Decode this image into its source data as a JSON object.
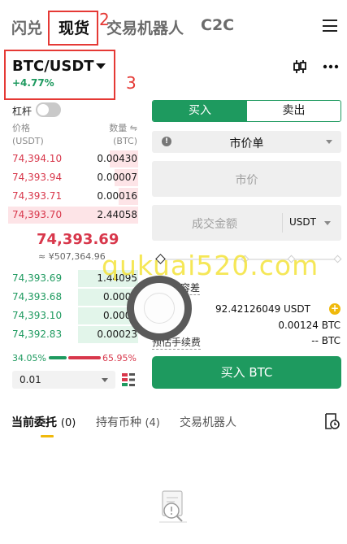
{
  "nav": {
    "tabs": [
      "闪兑",
      "现货",
      "交易机器人",
      "C2C"
    ],
    "active_index": 1
  },
  "annotations": {
    "tab_marker": "2",
    "pair_marker": "3"
  },
  "pair": {
    "name": "BTC/USDT",
    "change": "+4.77%"
  },
  "leverage": {
    "label": "杠杆",
    "enabled": false
  },
  "orderbook": {
    "price_header": "价格",
    "price_unit": "(USDT)",
    "qty_header": "数量 ⇋",
    "qty_unit": "(BTC)",
    "asks": [
      {
        "price": "74,394.10",
        "qty": "0.00430",
        "depth": 0.22
      },
      {
        "price": "74,393.94",
        "qty": "0.00007",
        "depth": 0.18
      },
      {
        "price": "74,393.71",
        "qty": "0.00016",
        "depth": 0.15
      },
      {
        "price": "74,393.70",
        "qty": "2.44058",
        "depth": 1.0
      }
    ],
    "last_price": "74,393.69",
    "last_price_cny": "≈ ¥507,364.96",
    "bids": [
      {
        "price": "74,393.69",
        "qty": "1.44095",
        "depth": 0.46
      },
      {
        "price": "74,393.68",
        "qty": "0.0002",
        "depth": 0.46
      },
      {
        "price": "74,393.10",
        "qty": "0.0002",
        "depth": 0.46
      },
      {
        "price": "74,392.83",
        "qty": "0.00023",
        "depth": 0.46
      }
    ],
    "buy_ratio": "34.05%",
    "sell_ratio": "65.95%",
    "precision": "0.01"
  },
  "order_form": {
    "buy_label": "买入",
    "sell_label": "卖出",
    "order_type": "市价单",
    "price_placeholder": "市价",
    "amount_placeholder": "成交金额",
    "amount_unit": "USDT",
    "slippage_label": "点容差",
    "available": "92.42126049 USDT",
    "max_buy": "0.00124 BTC",
    "est_label": "-- BTC",
    "fee_label": "预估手续费",
    "submit_label": "买入 BTC"
  },
  "bottom_tabs": [
    {
      "label": "当前委托",
      "count": "(0)"
    },
    {
      "label": "持有币种",
      "count": "(4)"
    },
    {
      "label": "交易机器人",
      "count": ""
    }
  ],
  "watermark": "qukuai520.com",
  "colors": {
    "up": "#1e9a5f",
    "down": "#d8374b",
    "accent": "#f0b90b",
    "annotation": "#e53935"
  }
}
